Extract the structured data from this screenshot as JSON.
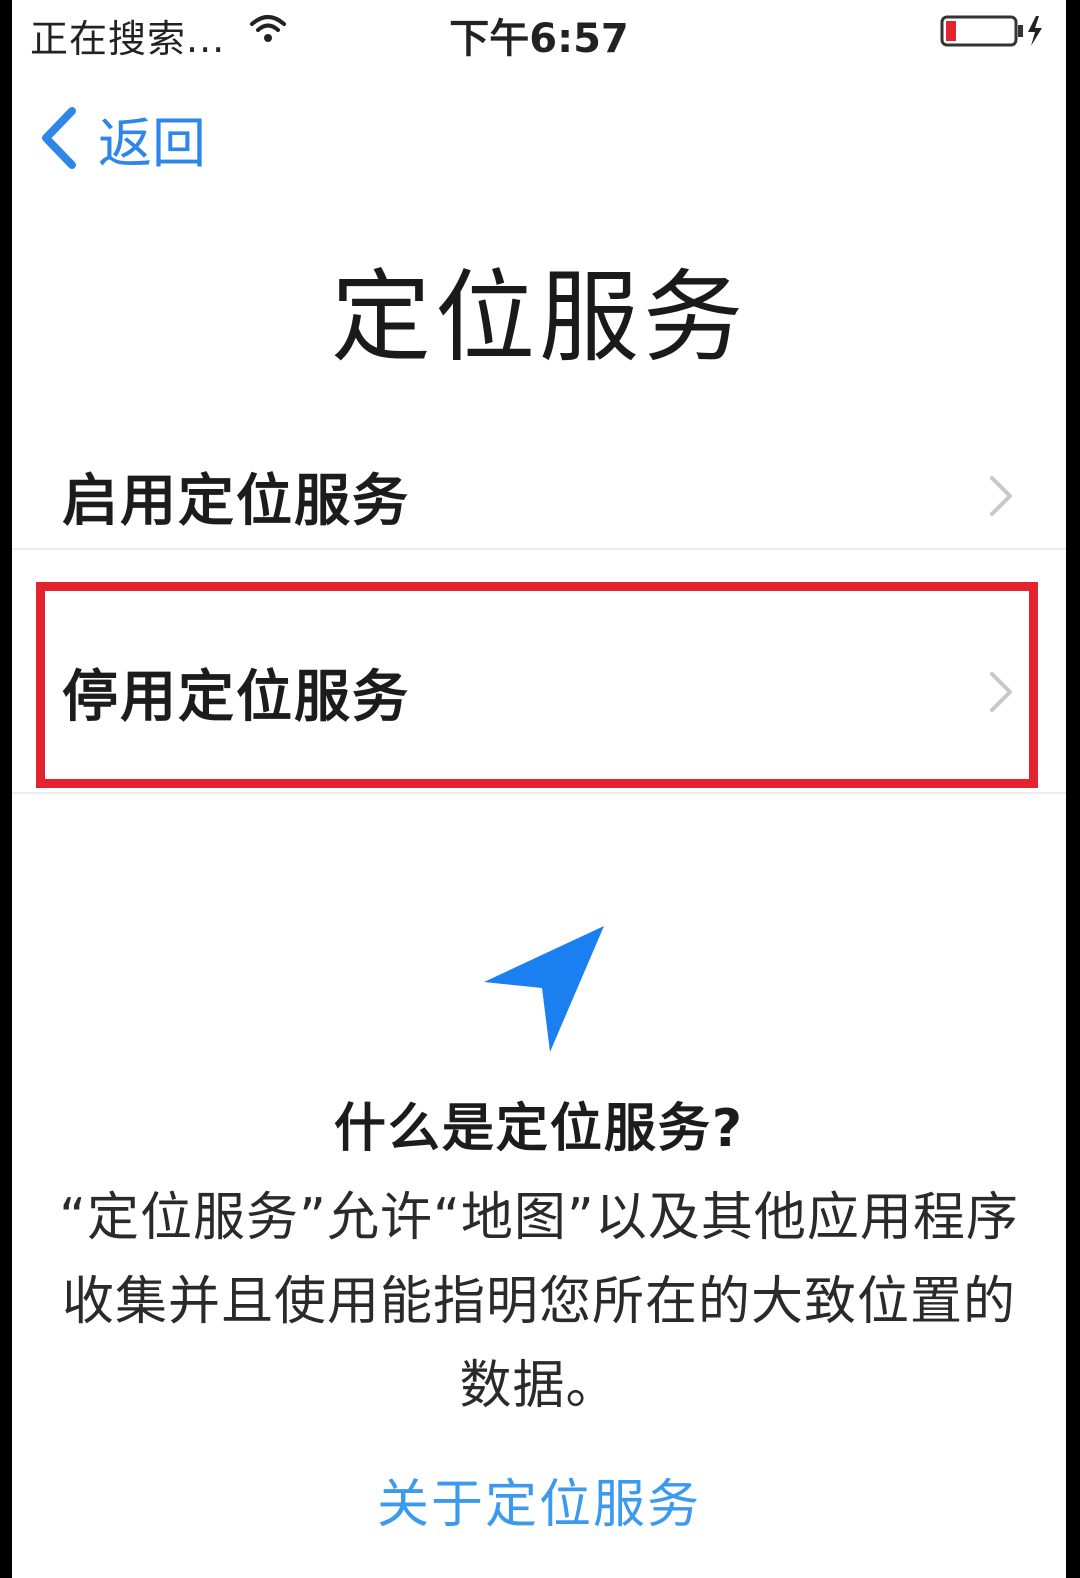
{
  "status_bar": {
    "carrier": "正在搜索...",
    "time": "下午6:57",
    "battery_color": "#e3232e"
  },
  "nav": {
    "back_label": "返回"
  },
  "page_title": "定位服务",
  "options": [
    {
      "label": "启用定位服务",
      "highlighted": false
    },
    {
      "label": "停用定位服务",
      "highlighted": true
    }
  ],
  "info": {
    "heading": "什么是定位服务?",
    "body": "“定位服务”允许“地图”以及其他应用程序收集并且使用能指明您所在的大致位置的数据。",
    "link": "关于定位服务"
  },
  "colors": {
    "accent": "#2e86e8",
    "highlight": "#e3232e"
  },
  "icons": [
    "wifi-icon",
    "battery-icon",
    "back-chevron-icon",
    "chevron-right-icon",
    "location-arrow-icon"
  ]
}
